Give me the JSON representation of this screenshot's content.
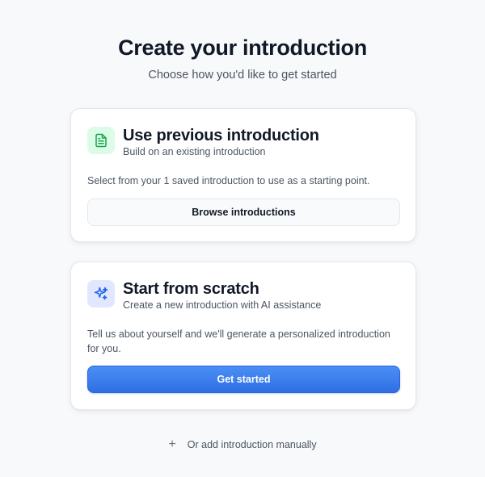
{
  "header": {
    "title": "Create your introduction",
    "subtitle": "Choose how you'd like to get started"
  },
  "previous_card": {
    "icon": "document-icon",
    "title": "Use previous introduction",
    "subtitle": "Build on an existing introduction",
    "description": "Select from your 1 saved introduction to use as a starting point.",
    "button_label": "Browse introductions"
  },
  "scratch_card": {
    "icon": "sparkles-icon",
    "title": "Start from scratch",
    "subtitle": "Create a new introduction with AI assistance",
    "description": "Tell us about yourself and we'll generate a personalized introduction for you.",
    "button_label": "Get started"
  },
  "footer": {
    "plus_icon": "+",
    "manual_label": "Or add introduction manually"
  },
  "colors": {
    "primary": "#3b82f6",
    "green_icon": "#16a34a",
    "blue_icon": "#2563eb"
  }
}
